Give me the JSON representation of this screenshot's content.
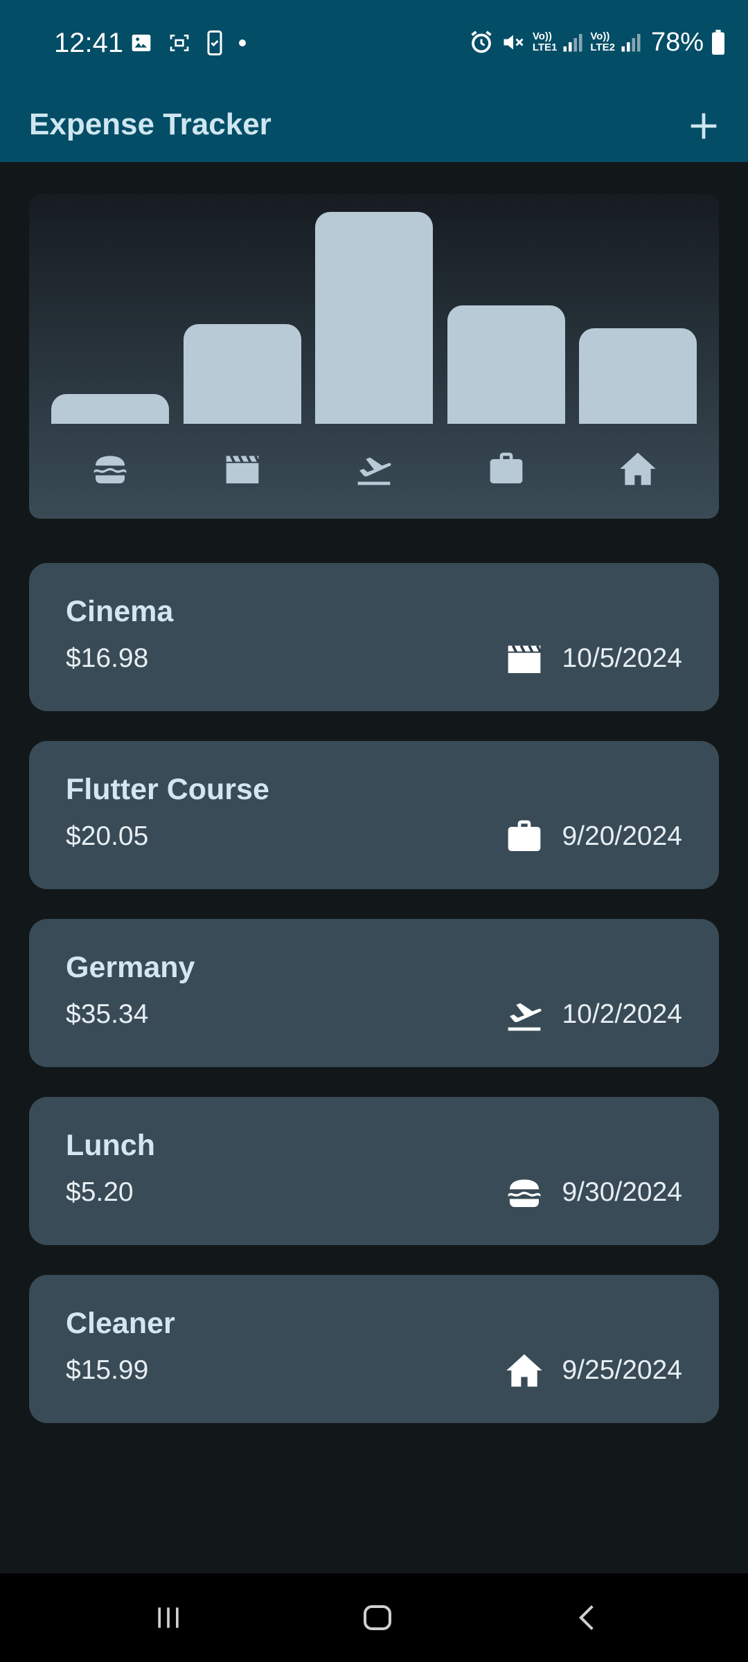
{
  "status_bar": {
    "time": "12:41",
    "battery": "78%",
    "sim1": [
      "Vo))",
      "LTE1"
    ],
    "sim2": [
      "Vo))",
      "LTE2"
    ],
    "left_icons": [
      "gallery-icon",
      "screenshot-icon",
      "phone-check-icon",
      "dot-icon"
    ],
    "right_icons": [
      "alarm-icon",
      "mute-icon",
      "signal-icon",
      "signal-icon",
      "battery-icon"
    ]
  },
  "app_bar": {
    "title": "Expense Tracker",
    "add_icon": "plus-icon"
  },
  "chart": {
    "categories": [
      {
        "name": "food",
        "icon": "burger-icon",
        "fill": 0.14
      },
      {
        "name": "leisure",
        "icon": "clapperboard-icon",
        "fill": 0.47
      },
      {
        "name": "travel",
        "icon": "plane-departure-icon",
        "fill": 1.0
      },
      {
        "name": "work",
        "icon": "briefcase-icon",
        "fill": 0.56
      },
      {
        "name": "home",
        "icon": "house-icon",
        "fill": 0.45
      }
    ],
    "bar_color": "#b8cad6",
    "icon_color": "#b8cad6"
  },
  "expenses": [
    {
      "title": "Cinema",
      "amount": "$16.98",
      "icon": "clapperboard-icon",
      "date": "10/5/2024"
    },
    {
      "title": "Flutter Course",
      "amount": "$20.05",
      "icon": "briefcase-icon",
      "date": "9/20/2024"
    },
    {
      "title": "Germany",
      "amount": "$35.34",
      "icon": "plane-departure-icon",
      "date": "10/2/2024"
    },
    {
      "title": "Lunch",
      "amount": "$5.20",
      "icon": "burger-icon",
      "date": "9/30/2024"
    },
    {
      "title": "Cleaner",
      "amount": "$15.99",
      "icon": "house-icon",
      "date": "9/25/2024"
    }
  ],
  "nav_bar": {
    "buttons": [
      "recent-apps-icon",
      "home-icon",
      "back-icon"
    ]
  },
  "colors": {
    "app_bar": "#034d66",
    "background": "#121719",
    "card": "#394b56",
    "title_text": "#cfe6f1"
  }
}
